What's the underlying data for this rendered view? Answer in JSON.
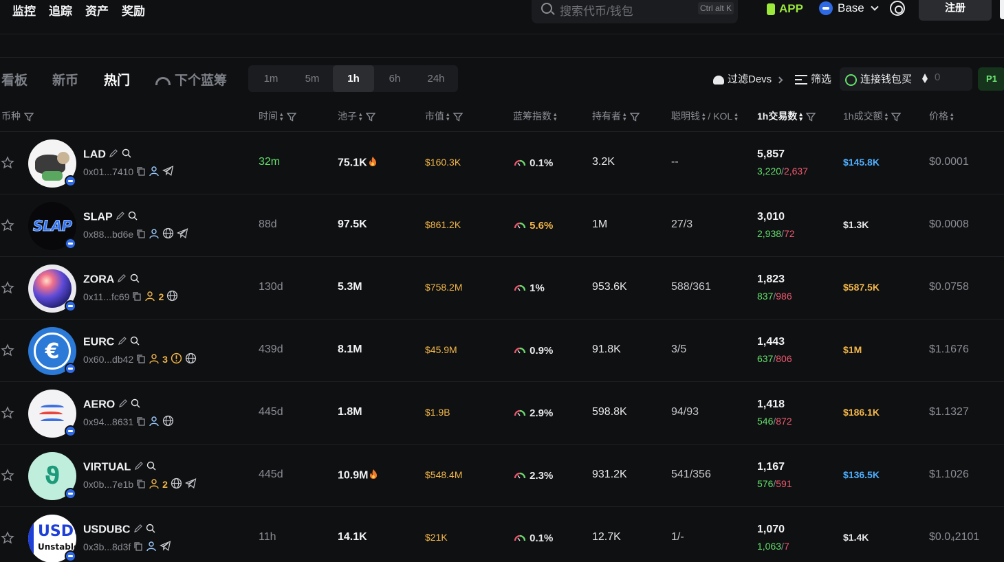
{
  "topnav": [
    "监控",
    "追踪",
    "资产",
    "奖励"
  ],
  "search": {
    "placeholder": "搜索代币/钱包",
    "shortcut": "Ctrl alt K"
  },
  "app_label": "APP",
  "chain_label": "Base",
  "register_label": "注册",
  "categories": [
    "看板",
    "新币",
    "热门",
    "下个蓝筹"
  ],
  "active_category": "热门",
  "timeframes": [
    "1m",
    "5m",
    "1h",
    "6h",
    "24h"
  ],
  "active_timeframe": "1h",
  "filters": {
    "devs": "过滤Devs",
    "screen": "筛选",
    "connect_buy": "连接钱包买",
    "amount": "0",
    "preset": "P1"
  },
  "columns": {
    "coin": "币种",
    "time": "时间",
    "pool": "池子",
    "mcap": "市值",
    "bluechip": "蓝筹指数",
    "holders": "持有者",
    "smart": "聪明钱",
    "kol": "/ KOL",
    "tx": "1h交易数",
    "vol": "1h成交额",
    "price": "价格"
  },
  "colors": {
    "accent_green": "#63e06b",
    "sell_red": "#ef5a6f",
    "orange": "#f3b74a",
    "blue": "#4fb0ff"
  },
  "rows": [
    {
      "symbol": "LAD",
      "address": "0x01...7410",
      "extras": [],
      "time": "32m",
      "pool": "75.1K",
      "pool_hot": true,
      "mcap": "$160.3K",
      "bluechip": "0.1%",
      "holders": "3.2K",
      "smart": "--",
      "tx": "5,857",
      "buys": "3,220",
      "sells": "2,637",
      "vol": "$145.8K",
      "price": "$0.0001"
    },
    {
      "symbol": "SLAP",
      "address": "0x88...bd6e",
      "extras": [],
      "time": "88d",
      "pool": "97.5K",
      "pool_hot": false,
      "mcap": "$861.2K",
      "bluechip": "5.6%",
      "holders": "1M",
      "smart": "27/3",
      "tx": "3,010",
      "buys": "2,938",
      "sells": "72",
      "vol": "$1.3K",
      "price": "$0.0008"
    },
    {
      "symbol": "ZORA",
      "address": "0x11...fc69",
      "extras": [
        "2"
      ],
      "time": "130d",
      "pool": "5.3M",
      "pool_hot": false,
      "mcap": "$758.2M",
      "bluechip": "1%",
      "holders": "953.6K",
      "smart": "588/361",
      "tx": "1,823",
      "buys": "837",
      "sells": "986",
      "vol": "$587.5K",
      "price": "$0.0758"
    },
    {
      "symbol": "EURC",
      "address": "0x60...db42",
      "extras": [
        "3"
      ],
      "time": "439d",
      "pool": "8.1M",
      "pool_hot": false,
      "mcap": "$45.9M",
      "bluechip": "0.9%",
      "holders": "91.8K",
      "smart": "3/5",
      "tx": "1,443",
      "buys": "637",
      "sells": "806",
      "vol": "$1M",
      "price": "$1.1676"
    },
    {
      "symbol": "AERO",
      "address": "0x94...8631",
      "extras": [],
      "time": "445d",
      "pool": "1.8M",
      "pool_hot": false,
      "mcap": "$1.9B",
      "bluechip": "2.9%",
      "holders": "598.8K",
      "smart": "94/93",
      "tx": "1,418",
      "buys": "546",
      "sells": "872",
      "vol": "$186.1K",
      "price": "$1.1327"
    },
    {
      "symbol": "VIRTUAL",
      "address": "0x0b...7e1b",
      "extras": [
        "2"
      ],
      "time": "445d",
      "pool": "10.9M",
      "pool_hot": true,
      "mcap": "$548.4M",
      "bluechip": "2.3%",
      "holders": "931.2K",
      "smart": "541/356",
      "tx": "1,167",
      "buys": "576",
      "sells": "591",
      "vol": "$136.5K",
      "price": "$1.1026"
    },
    {
      "symbol": "USDUBC",
      "address": "0x3b...8d3f",
      "extras": [],
      "time": "11h",
      "pool": "14.1K",
      "pool_hot": false,
      "mcap": "$21K",
      "bluechip": "0.1%",
      "holders": "12.7K",
      "smart": "1/-",
      "tx": "1,070",
      "buys": "1,063",
      "sells": "7",
      "vol": "$1.4K",
      "price": "$0.0₄2101"
    }
  ],
  "logo_text": {
    "slap": "SLAP",
    "usdubc_top": "USDU",
    "usdubc_bottom": "Unstable"
  }
}
